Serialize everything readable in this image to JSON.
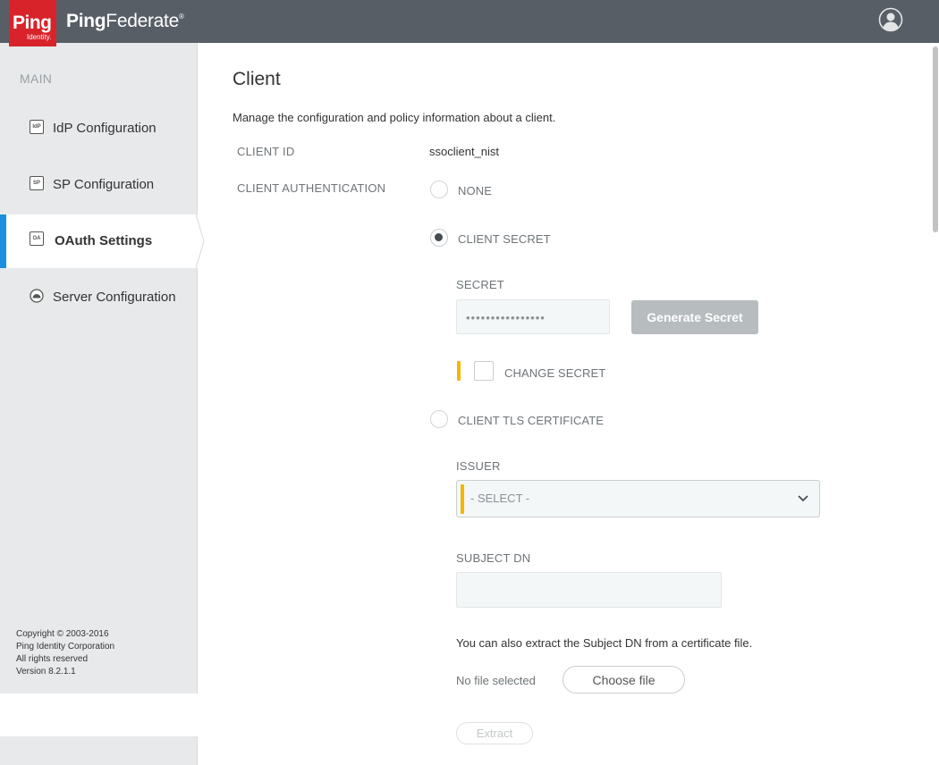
{
  "header": {
    "logo_ping": "Ping",
    "logo_identity": "Identity.",
    "brand_part1": "Ping",
    "brand_part2": "Federate",
    "brand_mark": "®"
  },
  "sidebar": {
    "section_label": "MAIN",
    "items": [
      {
        "icon_text": "IdP",
        "icon_name": "idp-icon",
        "label": "IdP Configuration"
      },
      {
        "icon_text": "SP",
        "icon_name": "sp-icon",
        "label": "SP Configuration"
      },
      {
        "icon_text": "OA",
        "icon_name": "oauth-icon",
        "label": "OAuth Settings",
        "active": true
      },
      {
        "icon_text": "",
        "icon_name": "server-icon",
        "label": "Server Configuration"
      }
    ],
    "copyright": [
      "Copyright © 2003-2016",
      "Ping Identity Corporation",
      "All rights reserved",
      "Version 8.2.1.1"
    ]
  },
  "main": {
    "title": "Client",
    "description": "Manage the configuration and policy information about a client.",
    "client_id_label": "CLIENT ID",
    "client_id_value": "ssoclient_nist",
    "client_auth_label": "CLIENT AUTHENTICATION",
    "auth_options": {
      "none": "NONE",
      "client_secret": "CLIENT SECRET",
      "client_tls": "CLIENT TLS CERTIFICATE"
    },
    "selected_auth": "client_secret",
    "secret_label": "SECRET",
    "secret_value": "••••••••••••••••",
    "generate_secret": "Generate Secret",
    "change_secret": "CHANGE SECRET",
    "change_secret_checked": false,
    "issuer_label": "ISSUER",
    "issuer_value": "- SELECT -",
    "subject_dn_label": "SUBJECT DN",
    "subject_dn_value": "",
    "extract_note": "You can also extract the Subject DN from a certificate file.",
    "no_file": "No file selected",
    "choose_file": "Choose file",
    "extract": "Extract"
  },
  "colors": {
    "topbar": "#575e66",
    "logo_red": "#d8232a",
    "active_bar": "#1b8ee0",
    "required_flag": "#f2b705",
    "button_disabled": "#b7bcbf"
  }
}
